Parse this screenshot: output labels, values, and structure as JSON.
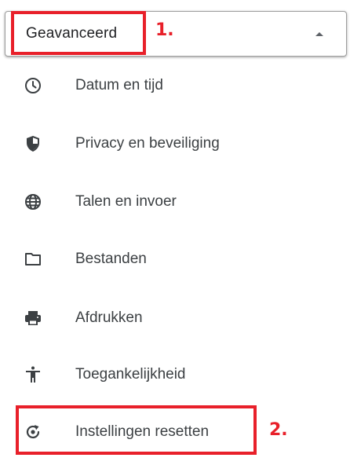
{
  "header": {
    "title": "Geavanceerd",
    "icon": "chevron-up-icon"
  },
  "menu": {
    "items": [
      {
        "label": "Datum en tijd",
        "icon": "clock-icon"
      },
      {
        "label": "Privacy en beveiliging",
        "icon": "shield-icon"
      },
      {
        "label": "Talen en invoer",
        "icon": "globe-icon"
      },
      {
        "label": "Bestanden",
        "icon": "folder-icon"
      },
      {
        "label": "Afdrukken",
        "icon": "printer-icon"
      },
      {
        "label": "Toegankelijkheid",
        "icon": "accessibility-icon"
      },
      {
        "label": "Instellingen resetten",
        "icon": "reset-icon"
      }
    ]
  },
  "annotations": [
    {
      "label": "1.",
      "color": "#e8202a"
    },
    {
      "label": "2.",
      "color": "#e8202a"
    }
  ],
  "colors": {
    "text": "#3c4043",
    "icon": "#3c4043",
    "annotation": "#e8202a"
  }
}
